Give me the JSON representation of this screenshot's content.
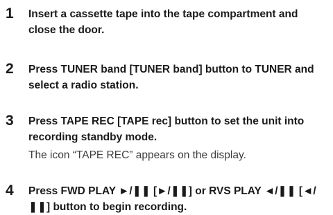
{
  "steps": [
    {
      "number": "1",
      "text": "Insert a cassette tape into the tape compartment and close the door."
    },
    {
      "number": "2",
      "text": "Press TUNER band [TUNER band] button to TUNER and select a radio station."
    },
    {
      "number": "3",
      "text": "Press TAPE REC [TAPE rec] button to set the unit into recording standby mode.",
      "note": "The icon “TAPE REC” appears on the display."
    },
    {
      "number": "4",
      "text": "Press FWD PLAY ►/❚❚ [►/❚❚] or RVS PLAY ◄/❚❚ [◄/❚❚] button to begin recording."
    }
  ]
}
